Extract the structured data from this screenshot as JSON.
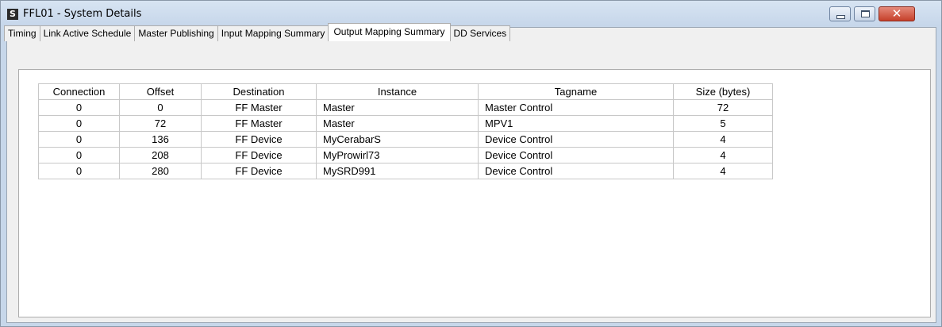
{
  "window": {
    "app_icon": "S",
    "title": "FFL01 - System Details"
  },
  "tabs": [
    {
      "label": "Timing",
      "active": false
    },
    {
      "label": "Link Active Schedule",
      "active": false
    },
    {
      "label": "Master Publishing",
      "active": false
    },
    {
      "label": "Input Mapping Summary",
      "active": false
    },
    {
      "label": "Output Mapping Summary",
      "active": true
    },
    {
      "label": "DD Services",
      "active": false
    }
  ],
  "table": {
    "headers": [
      "Connection",
      "Offset",
      "Destination",
      "Instance",
      "Tagname",
      "Size (bytes)"
    ],
    "rows": [
      [
        "0",
        "0",
        "FF Master",
        "Master",
        "Master Control",
        "72"
      ],
      [
        "0",
        "72",
        "FF Master",
        "Master",
        "MPV1",
        "5"
      ],
      [
        "0",
        "136",
        "FF Device",
        "MyCerabarS",
        "Device Control",
        "4"
      ],
      [
        "0",
        "208",
        "FF Device",
        "MyProwirl73",
        "Device Control",
        "4"
      ],
      [
        "0",
        "280",
        "FF Device",
        "MySRD991",
        "Device Control",
        "4"
      ]
    ]
  },
  "icons": {
    "minimize": "minimize-icon",
    "maximize": "maximize-icon",
    "close": "close-icon"
  },
  "colors": {
    "titlebar": "#c6d6ea",
    "close_button": "#c6402a"
  }
}
